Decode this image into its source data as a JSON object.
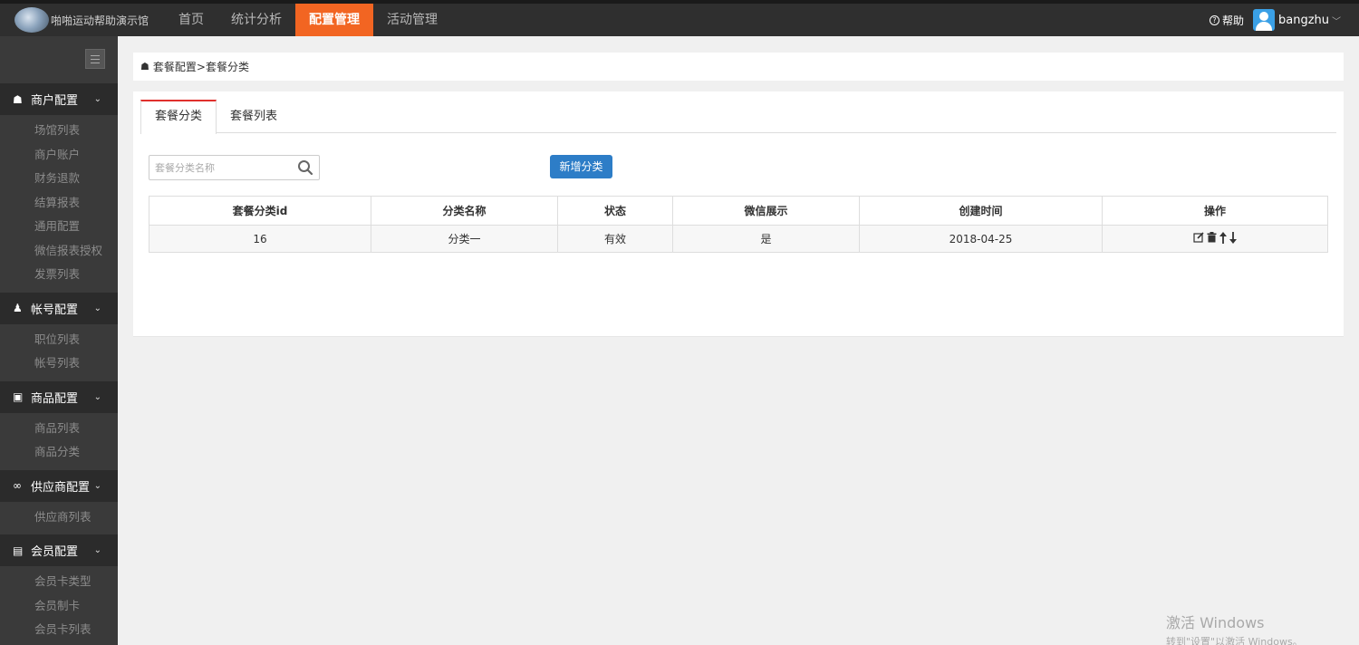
{
  "header": {
    "brand": "啪啪运动帮助演示馆",
    "nav": [
      "首页",
      "统计分析",
      "配置管理",
      "活动管理"
    ],
    "help_label": "帮助",
    "username": "bangzhu"
  },
  "sidebar": {
    "sections": [
      {
        "title": "商户配置",
        "icon": "home-icon",
        "items": [
          "场馆列表",
          "商户账户",
          "财务退款",
          "结算报表",
          "通用配置",
          "微信报表授权",
          "发票列表"
        ]
      },
      {
        "title": "帐号配置",
        "icon": "user-icon",
        "items": [
          "职位列表",
          "帐号列表"
        ]
      },
      {
        "title": "商品配置",
        "icon": "gift-icon",
        "items": [
          "商品列表",
          "商品分类"
        ]
      },
      {
        "title": "供应商配置",
        "icon": "link-icon",
        "items": [
          "供应商列表"
        ]
      },
      {
        "title": "会员配置",
        "icon": "id-card-icon",
        "items": [
          "会员卡类型",
          "会员制卡",
          "会员卡列表"
        ]
      }
    ]
  },
  "breadcrumb": {
    "parent": "套餐配置",
    "separator": " > ",
    "current": "套餐分类"
  },
  "tabs": [
    "套餐分类",
    "套餐列表"
  ],
  "search": {
    "placeholder": "套餐分类名称"
  },
  "add_button": "新增分类",
  "table": {
    "headers": [
      "套餐分类id",
      "分类名称",
      "状态",
      "微信展示",
      "创建时间",
      "操作"
    ],
    "rows": [
      {
        "id": "16",
        "name": "分类一",
        "status": "有效",
        "wechat": "是",
        "created": "2018-04-25"
      }
    ]
  },
  "watermark": {
    "line1": "激活 Windows",
    "line2": "转到\"设置\"以激活 Windows。"
  },
  "colors": {
    "topbar": "#2f2f2f",
    "active_nav": "#f26522",
    "sidebar": "#3a3a3a",
    "primary_button": "#2d7dc7",
    "active_tab_border": "#e0302d"
  }
}
